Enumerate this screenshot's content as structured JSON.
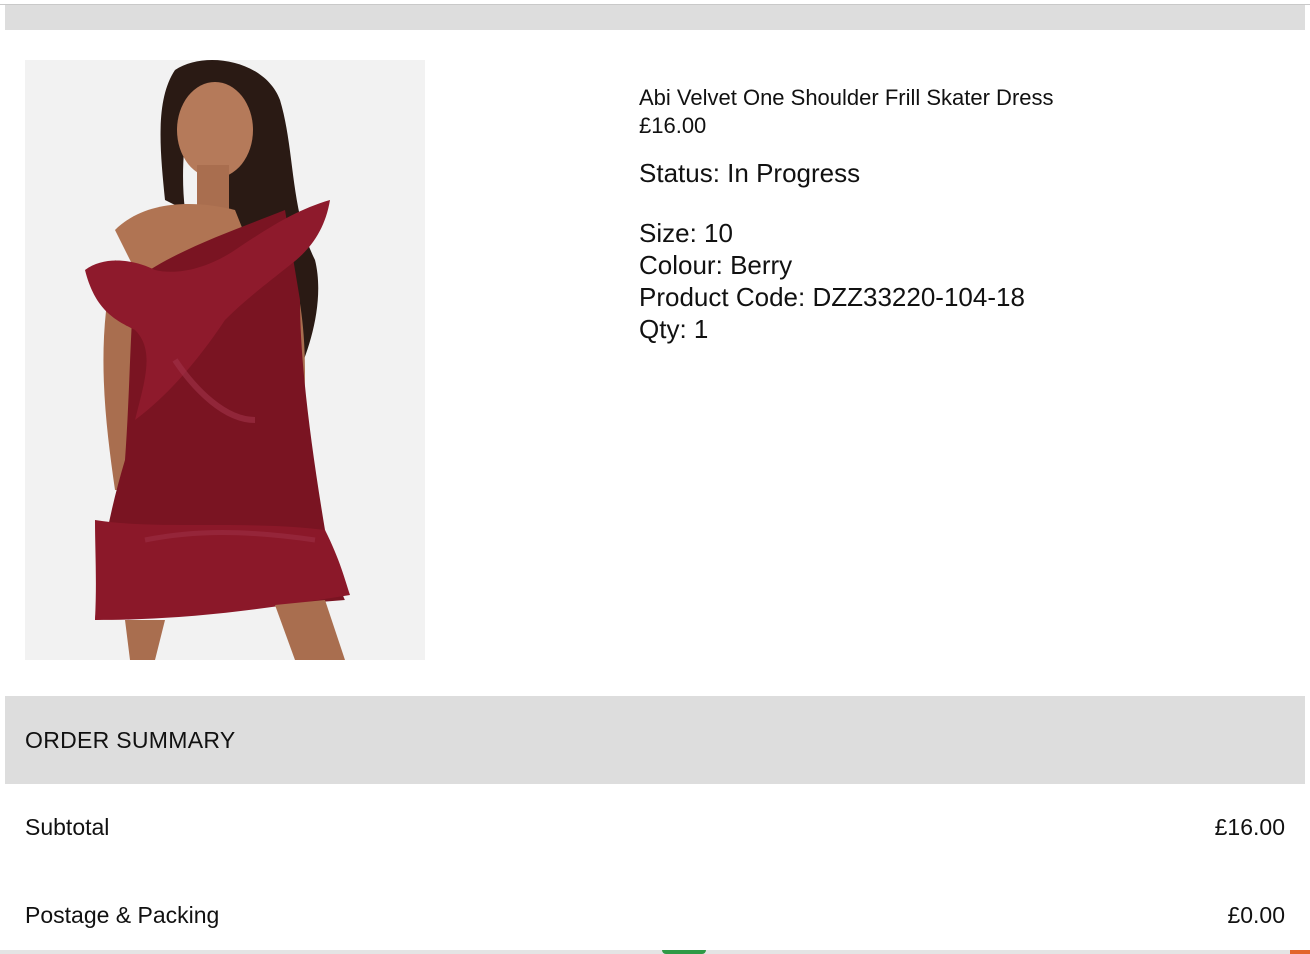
{
  "product": {
    "image_icon": "product-photo-dress",
    "name": "Abi Velvet One Shoulder Frill Skater Dress",
    "price": "£16.00",
    "status_label": "Status:",
    "status_value": "In Progress",
    "attributes": [
      {
        "label": "Size:",
        "value": "10"
      },
      {
        "label": "Colour:",
        "value": "Berry"
      },
      {
        "label": "Product Code:",
        "value": "DZZ33220-104-18"
      },
      {
        "label": "Qty:",
        "value": "1"
      }
    ],
    "dress_color": "#7a1422"
  },
  "summary": {
    "title": "ORDER SUMMARY",
    "rows": [
      {
        "label": "Subtotal",
        "value": "£16.00"
      },
      {
        "label": "Postage & Packing",
        "value": "£0.00"
      }
    ]
  },
  "colors": {
    "header_bg": "#dddddd",
    "page_bg": "#ffffff",
    "text": "#111111"
  }
}
